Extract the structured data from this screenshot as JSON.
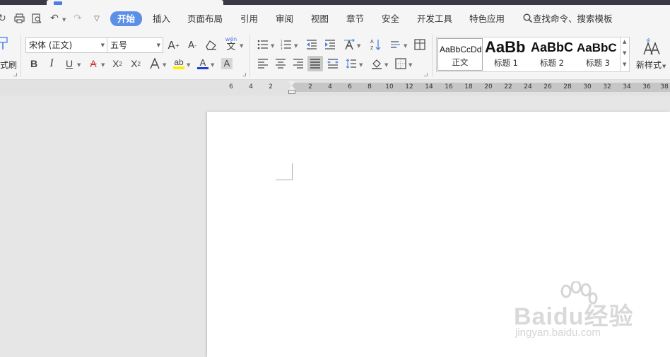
{
  "menu": {
    "items": [
      "开始",
      "插入",
      "页面布局",
      "引用",
      "审阅",
      "视图",
      "章节",
      "安全",
      "开发工具",
      "特色应用"
    ],
    "active": "开始",
    "search_label": "查找命令、搜索模板"
  },
  "toolbar": {
    "format_painter_label": "式刷",
    "font_name": "宋体 (正文)",
    "font_size": "五号",
    "new_style_label": "新样式"
  },
  "styles": [
    {
      "sample": "AaBbCcDd",
      "name": "正文"
    },
    {
      "sample": "AaBb",
      "name": "标题 1"
    },
    {
      "sample": "AaBbC",
      "name": "标题 2"
    },
    {
      "sample": "AaBbC",
      "name": "标题 3"
    }
  ],
  "ruler": {
    "left_ticks": [
      "6",
      "4",
      "2"
    ],
    "right_ticks": [
      "2",
      "4",
      "6",
      "8",
      "10",
      "12",
      "14",
      "16",
      "18",
      "20",
      "22",
      "24",
      "26",
      "28",
      "30",
      "32",
      "34",
      "36",
      "38"
    ]
  },
  "watermark": {
    "brand": "Baidu经验",
    "url": "jingyan.baidu.com"
  },
  "colors": {
    "accent": "#5b8fe8",
    "highlight": "#ffee00",
    "font_color": "#1f3fd6"
  }
}
